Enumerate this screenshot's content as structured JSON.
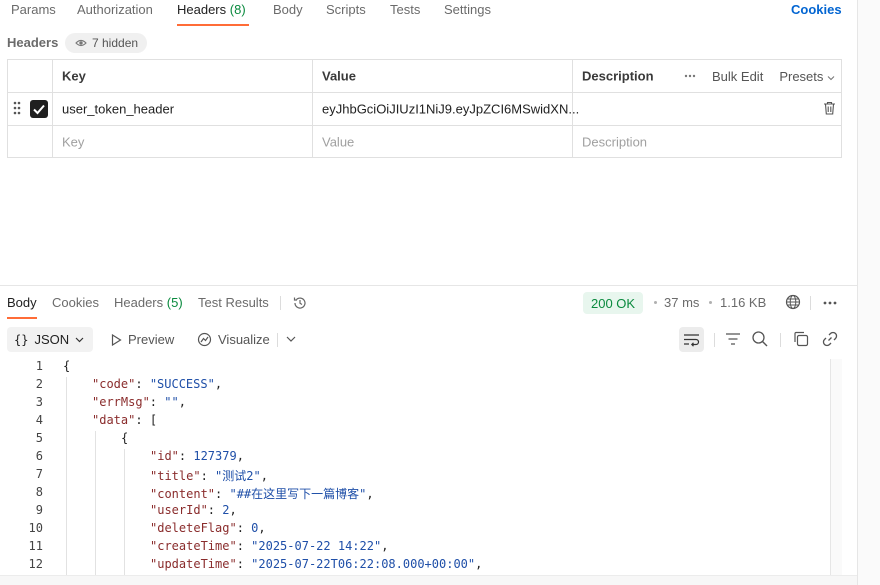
{
  "request_tabs": [
    {
      "label": "Params"
    },
    {
      "label": "Authorization"
    },
    {
      "label": "Headers",
      "count": "(8)"
    },
    {
      "label": "Body"
    },
    {
      "label": "Scripts"
    },
    {
      "label": "Tests"
    },
    {
      "label": "Settings"
    }
  ],
  "cookies_link": "Cookies",
  "headers_section": {
    "label": "Headers",
    "hidden_pill": "7 hidden"
  },
  "headers_table": {
    "columns": {
      "key": "Key",
      "value": "Value",
      "description": "Description"
    },
    "actions": {
      "bulk_edit": "Bulk Edit",
      "presets": "Presets"
    },
    "rows": [
      {
        "checked": true,
        "key": "user_token_header",
        "value": "eyJhbGciOiJIUzI1NiJ9.eyJpZCI6MSwidXN...",
        "description": ""
      }
    ],
    "placeholders": {
      "key": "Key",
      "value": "Value",
      "description": "Description"
    }
  },
  "response_tabs": [
    {
      "label": "Body"
    },
    {
      "label": "Cookies"
    },
    {
      "label": "Headers",
      "count": "(5)"
    },
    {
      "label": "Test Results"
    }
  ],
  "response_meta": {
    "status": "200 OK",
    "time": "37 ms",
    "size": "1.16 KB"
  },
  "body_toolbar": {
    "format": "JSON",
    "preview": "Preview",
    "visualize": "Visualize"
  },
  "code": {
    "line_numbers": [
      "1",
      "2",
      "3",
      "4",
      "5",
      "6",
      "7",
      "8",
      "9",
      "10",
      "11",
      "12"
    ],
    "l1": "{",
    "l2_key": "\"code\"",
    "l2_val": "\"SUCCESS\"",
    "l3_key": "\"errMsg\"",
    "l3_val": "\"\"",
    "l4_key": "\"data\"",
    "l4_open": "[",
    "l5": "{",
    "l6_key": "\"id\"",
    "l6_val": "127379",
    "l7_key": "\"title\"",
    "l7_val": "\"测试2\"",
    "l8_key": "\"content\"",
    "l8_val": "\"##在这里写下一篇博客\"",
    "l9_key": "\"userId\"",
    "l9_val": "2",
    "l10_key": "\"deleteFlag\"",
    "l10_val": "0",
    "l11_key": "\"createTime\"",
    "l11_val": "\"2025-07-22 14:22\"",
    "l12_key": "\"updateTime\"",
    "l12_val": "\"2025-07-22T06:22:08.000+00:00\""
  },
  "colors": {
    "accent": "#ff6c37",
    "link": "#0265d2",
    "success": "#0a8a3e"
  }
}
